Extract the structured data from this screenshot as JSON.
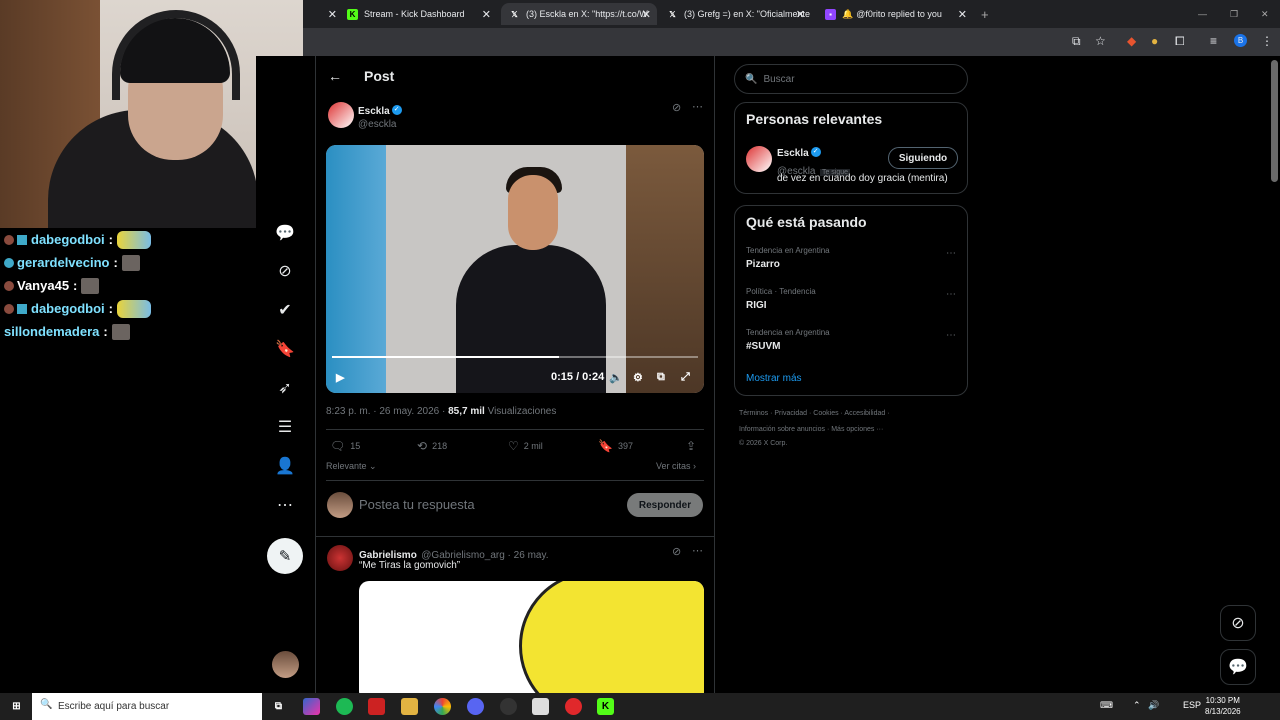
{
  "tabs": [
    {
      "label": "",
      "active": false
    },
    {
      "label": "Stream - Kick Dashboard",
      "active": false
    },
    {
      "label": "(3) Esckla en X: \"https://t.co/W",
      "active": true
    },
    {
      "label": "(3) Grefg =) en X: \"Oficialmente",
      "active": false
    },
    {
      "label": "@f0rito replied to you",
      "active": false
    }
  ],
  "chat": [
    {
      "user": "dabegodboi",
      "emote": "wide",
      "badges": true,
      "cyan": true
    },
    {
      "user": "gerardelvecino",
      "emote": "small",
      "badges": false,
      "cyan": true
    },
    {
      "user": "Vanya45",
      "emote": "small",
      "badges": false,
      "cyan": false
    },
    {
      "user": "dabegodboi",
      "emote": "wide",
      "badges": true,
      "cyan": true
    },
    {
      "user": "sillondemadera",
      "emote": "small",
      "badges": false,
      "cyan": true
    }
  ],
  "chat_sep": ":",
  "post": {
    "header": "Post",
    "author_name": "Esckla",
    "author_handle": "@esckla",
    "video_time": "0:15 / 0:24",
    "video_progress": 0.62,
    "timestamp": "8:23 p. m. · 26 may. 2026 · ",
    "views": "85,7 mil",
    "views_label": "Visualizaciones",
    "replies": "15",
    "reposts": "218",
    "likes": "2 mil",
    "bookmarks": "397",
    "sort": "Relevante",
    "quotes": "Ver citas",
    "reply_placeholder": "Postea tu respuesta",
    "reply_button": "Responder"
  },
  "reply": {
    "name": "Gabrielismo",
    "handle": "@Gabrielismo_arg · 26 may.",
    "text": "“Me Tiras la gomovich”"
  },
  "sidebar": {
    "search_placeholder": "Buscar",
    "relevant_title": "Personas relevantes",
    "relevant_name": "Esckla",
    "relevant_handle": "@esckla",
    "follows_you": "Te sigue",
    "follow_button": "Siguiendo",
    "bio": "de vez en cuando doy gracia (mentira)",
    "trending_title": "Qué está pasando",
    "trends": [
      {
        "context": "Tendencia en Argentina",
        "name": "Pizarro"
      },
      {
        "context": "Política · Tendencia",
        "name": "RIGI"
      },
      {
        "context": "Tendencia en Argentina",
        "name": "#SUVM"
      }
    ],
    "show_more": "Mostrar más",
    "footer1": "Términos · Privacidad · Cookies · Accesibilidad ·",
    "footer2": "Información sobre anuncios · Más opciones ···",
    "footer3": "© 2026 X Corp."
  },
  "taskbar": {
    "search": "Escribe aquí para buscar",
    "lang": "ESP",
    "time": "10:30 PM",
    "date": "8/13/2026"
  },
  "colors": {
    "accent": "#1d9bf0",
    "kick": "#53fc18"
  }
}
